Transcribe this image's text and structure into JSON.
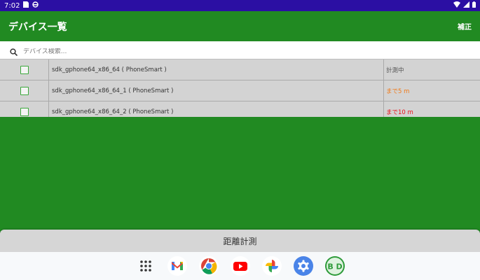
{
  "status_bar": {
    "time": "7:02",
    "icons": [
      "sim-card-icon",
      "sync-icon"
    ],
    "right_icons": [
      "wifi-icon",
      "signal-icon",
      "battery-icon"
    ]
  },
  "app_bar": {
    "title": "デバイス一覧",
    "action_label": "補正"
  },
  "search": {
    "placeholder": "デバイス検索..."
  },
  "devices": [
    {
      "name": "sdk_gphone64_x86_64 ( PhoneSmart )",
      "status": "計測中",
      "status_color": "#555555",
      "checked": false
    },
    {
      "name": "sdk_gphone64_x86_64_1 ( PhoneSmart )",
      "status": "まで5 m",
      "status_color": "#f07a1a",
      "checked": false
    },
    {
      "name": "sdk_gphone64_x86_64_2 ( PhoneSmart )",
      "status": "まで10 m",
      "status_color": "#e8121a",
      "checked": false
    }
  ],
  "measure_button": {
    "label": "距離計測"
  },
  "dock": {
    "apps": [
      "app-drawer-icon",
      "gmail-icon",
      "chrome-icon",
      "youtube-icon",
      "photos-icon",
      "settings-icon",
      "bd-app-icon"
    ],
    "bd_label": "B D"
  },
  "colors": {
    "status_bar": "#2b0fa3",
    "primary_green": "#218a22",
    "list_bg": "#d3d3d3"
  }
}
